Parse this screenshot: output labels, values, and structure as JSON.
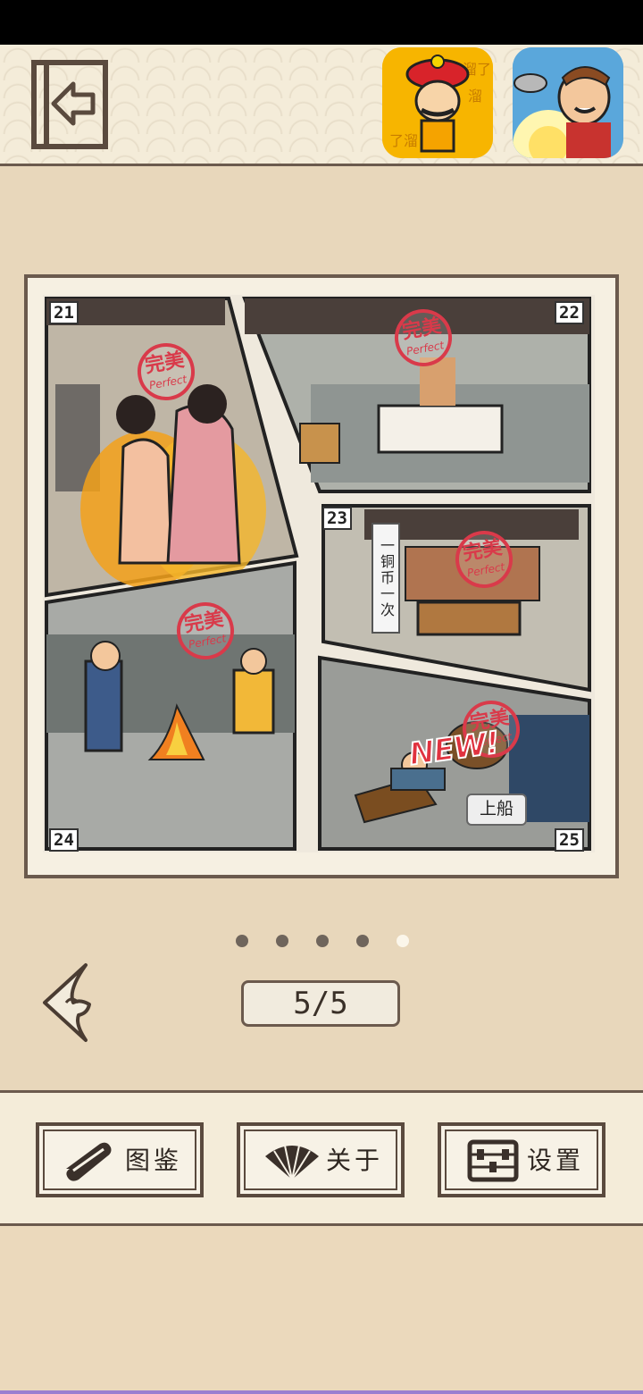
{
  "header": {
    "exit_icon": "exit-door-arrow-icon",
    "ads": [
      {
        "name": "ad-app-official-icon",
        "text": "溜了溜了"
      },
      {
        "name": "ad-app-chef-icon"
      }
    ]
  },
  "comic": {
    "panels": [
      {
        "number": "21",
        "stamp_cn": "完美",
        "stamp_en": "Perfect"
      },
      {
        "number": "22",
        "stamp_cn": "完美",
        "stamp_en": "Perfect"
      },
      {
        "number": "23",
        "stamp_cn": "完美",
        "stamp_en": "Perfect",
        "sign_text": "一铜币一次"
      },
      {
        "number": "24",
        "stamp_cn": "完美",
        "stamp_en": "Perfect"
      },
      {
        "number": "25",
        "stamp_cn": "完美",
        "stamp_en": "Perfect",
        "badge": "NEW!",
        "button": "上船"
      }
    ]
  },
  "pager": {
    "dot_count": 5,
    "active_index": 4,
    "indicator": "5/5"
  },
  "menu": {
    "album": "图鉴",
    "about": "关于",
    "settings": "设置"
  },
  "colors": {
    "accent_red": "#d93a4a",
    "frame_brown": "#6b5a4d",
    "parchment": "#eadcc2"
  }
}
